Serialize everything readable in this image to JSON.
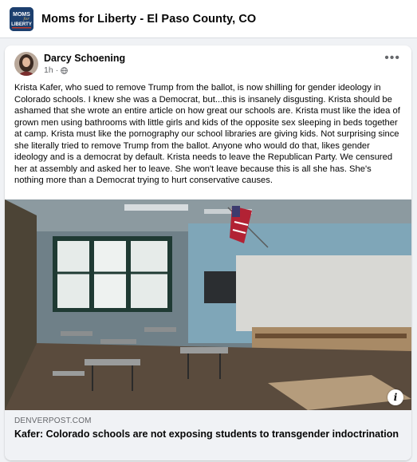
{
  "group": {
    "name": "Moms for Liberty - El Paso County, CO",
    "logo_text_top": "MOMS",
    "logo_text_script": "for",
    "logo_text_bottom": "LIBERTY",
    "logo_color": "#1c3f6e"
  },
  "post": {
    "author": "Darcy Schoening",
    "time": "1h",
    "separator": "·",
    "audience_icon": "globe-icon",
    "more_label": "•••",
    "text": "Krista Kafer, who sued to remove Trump from the ballot, is now shilling for gender ideology in Colorado schools. I knew she was a Democrat, but...this is insanely disgusting. Krista should be ashamed that she wrote an entire article on how great our schools are. Krista must like the idea of grown men using bathrooms with little girls and kids of the opposite sex sleeping in beds together at camp. Krista must like the pornography our school libraries are giving kids. Not surprising since she literally tried to remove Trump from the ballot. Anyone who would do that, likes gender ideology and is a democrat by default. Krista needs to leave the Republican Party. We censured her at assembly and asked her to leave. She won't leave because this is all she has. She's nothing more than a Democrat trying to hurt conservative causes."
  },
  "link": {
    "domain": "DENVERPOST.COM",
    "title": "Kafer: Colorado schools are not exposing students to transgender indoctrination",
    "info_label": "i"
  }
}
